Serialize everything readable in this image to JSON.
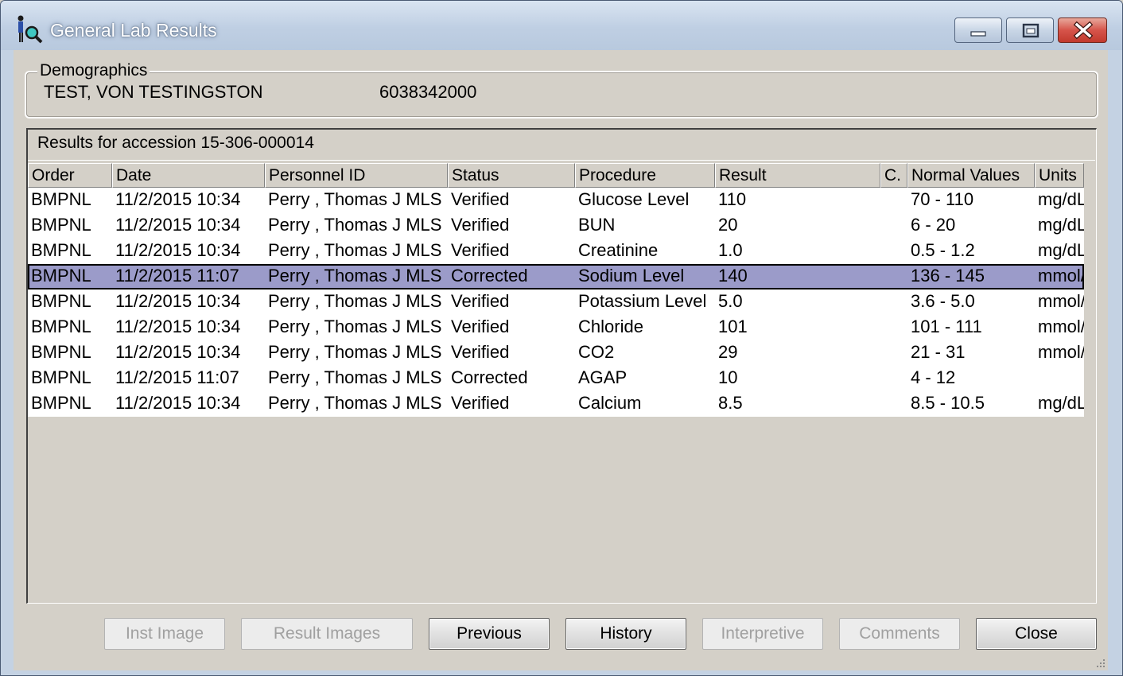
{
  "window": {
    "title": "General Lab Results"
  },
  "demographics": {
    "group_label": "Demographics",
    "patient_name": "TEST, VON TESTINGSTON",
    "patient_id": "6038342000"
  },
  "results": {
    "label": "Results for accession 15-306-000014",
    "columns": [
      "Order",
      "Date",
      "Personnel ID",
      "Status",
      "Procedure",
      "Result",
      "C.",
      "Normal Values",
      "Units"
    ],
    "rows": [
      {
        "order": "BMPNL",
        "date": "11/2/2015 10:34",
        "personnel": "Perry , Thomas J MLS",
        "status": "Verified",
        "procedure": "Glucose Level",
        "result": "110",
        "c": "",
        "normal": "70 - 110",
        "units": "mg/dL"
      },
      {
        "order": "BMPNL",
        "date": "11/2/2015 10:34",
        "personnel": "Perry , Thomas J MLS",
        "status": "Verified",
        "procedure": "BUN",
        "result": "20",
        "c": "",
        "normal": "6 - 20",
        "units": "mg/dL"
      },
      {
        "order": "BMPNL",
        "date": "11/2/2015 10:34",
        "personnel": "Perry , Thomas J MLS",
        "status": "Verified",
        "procedure": "Creatinine",
        "result": "1.0",
        "c": "",
        "normal": "0.5 - 1.2",
        "units": "mg/dL"
      },
      {
        "order": "BMPNL",
        "date": "11/2/2015 11:07",
        "personnel": "Perry , Thomas J MLS",
        "status": "Corrected",
        "procedure": "Sodium Level",
        "result": "140",
        "c": "",
        "normal": "136 - 145",
        "units": "mmol/",
        "selected": true
      },
      {
        "order": "BMPNL",
        "date": "11/2/2015 10:34",
        "personnel": "Perry , Thomas J MLS",
        "status": "Verified",
        "procedure": "Potassium Level",
        "result": "5.0",
        "c": "",
        "normal": "3.6 - 5.0",
        "units": "mmol/"
      },
      {
        "order": "BMPNL",
        "date": "11/2/2015 10:34",
        "personnel": "Perry , Thomas J MLS",
        "status": "Verified",
        "procedure": "Chloride",
        "result": "101",
        "c": "",
        "normal": "101 - 111",
        "units": "mmol/"
      },
      {
        "order": "BMPNL",
        "date": "11/2/2015 10:34",
        "personnel": "Perry , Thomas J MLS",
        "status": "Verified",
        "procedure": "CO2",
        "result": "29",
        "c": "",
        "normal": "21 - 31",
        "units": "mmol/"
      },
      {
        "order": "BMPNL",
        "date": "11/2/2015 11:07",
        "personnel": "Perry , Thomas J MLS",
        "status": "Corrected",
        "procedure": "AGAP",
        "result": "10",
        "c": "",
        "normal": "4 - 12",
        "units": ""
      },
      {
        "order": "BMPNL",
        "date": "11/2/2015 10:34",
        "personnel": "Perry , Thomas J MLS",
        "status": "Verified",
        "procedure": "Calcium",
        "result": "8.5",
        "c": "",
        "normal": "8.5 - 10.5",
        "units": "mg/dL"
      }
    ]
  },
  "buttons": {
    "inst_image": "Inst Image",
    "result_images": "Result Images",
    "previous": "Previous",
    "history": "History",
    "interpretive": "Interpretive",
    "comments": "Comments",
    "close": "Close"
  },
  "colors": {
    "selection": "#9b9bc9",
    "face": "#d4d0c8",
    "titlebar": "#c4d2e3",
    "close_button": "#d6544a"
  },
  "icons": [
    "app-icon",
    "minimize-icon",
    "maximize-icon",
    "close-icon",
    "resize-grip-icon"
  ]
}
